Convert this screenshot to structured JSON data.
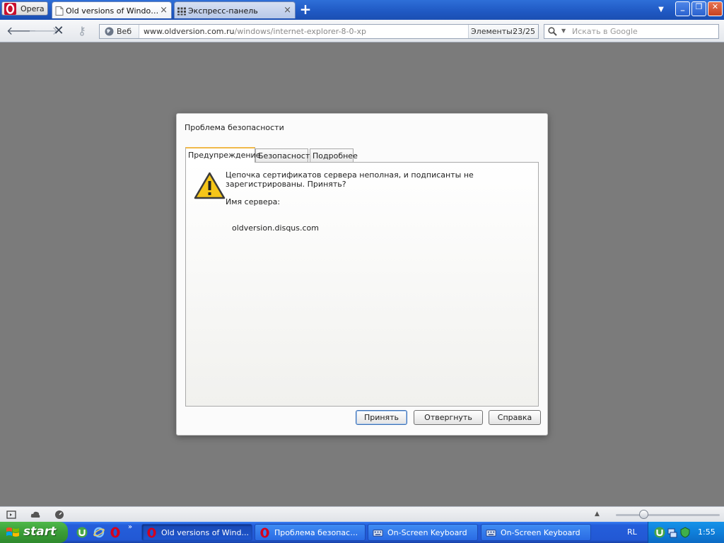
{
  "browser": {
    "menu_label": "Opera",
    "tabs": [
      {
        "title": "Old versions of Windows...",
        "active": true
      },
      {
        "title": "Экспресс-панель",
        "active": false
      }
    ],
    "tab_close_glyph": "×",
    "new_tab_glyph": "+",
    "window_buttons": {
      "minimize": "_",
      "maximize": "❐",
      "close": "✕"
    }
  },
  "address_bar": {
    "web_badge": "Веб",
    "url_domain": "www.oldversion.com.ru",
    "url_path": "/windows/internet-explorer-8-0-xp",
    "elements_label": "Элементы:",
    "elements_count": "23/25",
    "search_placeholder": "Искать в Google"
  },
  "dialog": {
    "title": "Проблема безопасности",
    "tabs": [
      "Предупреждение",
      "Безопасность",
      "Подробнее"
    ],
    "message": "Цепочка сертификатов сервера неполная, и подписанты не зарегистрированы. Принять?",
    "server_label": "Имя сервера:",
    "server_name": "oldversion.disqus.com",
    "buttons": {
      "accept": "Принять",
      "reject": "Отвергнуть",
      "help": "Справка"
    }
  },
  "taskbar": {
    "start_label": "start",
    "tasks": [
      {
        "label": "Old versions of Wind...",
        "icon": "opera-icon",
        "active": true
      },
      {
        "label": "Проблема безопасно...",
        "icon": "opera-icon",
        "active": false
      },
      {
        "label": "On-Screen Keyboard",
        "icon": "keyboard-icon",
        "active": false
      },
      {
        "label": "On-Screen Keyboard",
        "icon": "keyboard-icon",
        "active": false
      }
    ],
    "language": "RL",
    "clock": "1:55"
  },
  "colors": {
    "tabbar_blue": "#1f58c2",
    "backdrop_gray": "#7b7b7b",
    "warning_yellow": "#f5c518",
    "taskbar_blue": "#245edb",
    "start_green": "#3a9c37"
  }
}
